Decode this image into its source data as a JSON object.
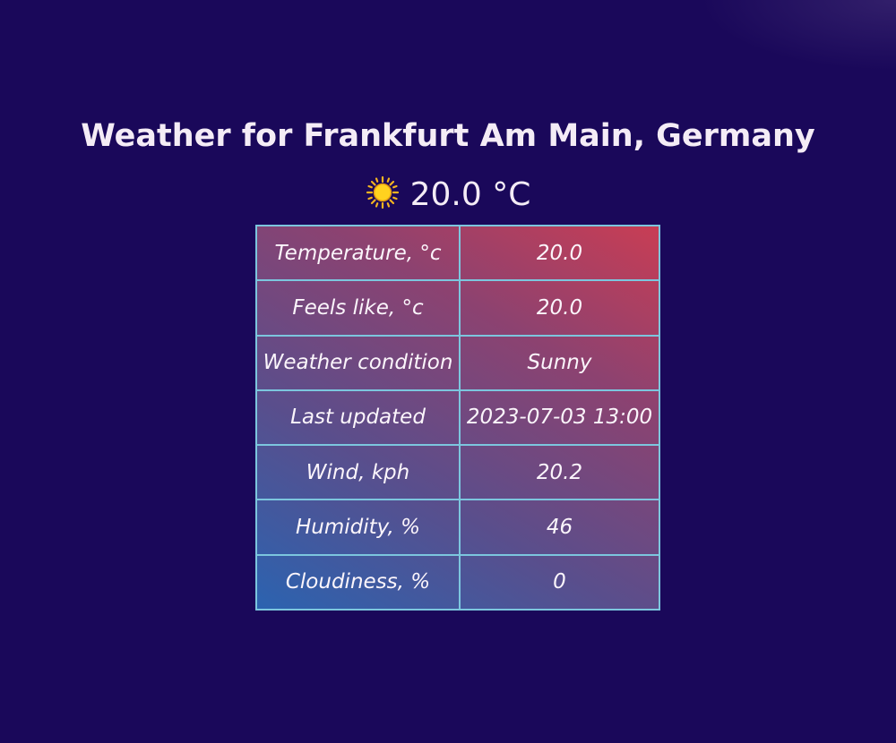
{
  "header": {
    "title": "Weather for Frankfurt Am Main, Germany"
  },
  "current": {
    "icon": "sun-icon",
    "temperature_text": "20.0 °C"
  },
  "table": {
    "rows": [
      {
        "label": "Temperature, °c",
        "value": "20.0"
      },
      {
        "label": "Feels like, °c",
        "value": "20.0"
      },
      {
        "label": "Weather condition",
        "value": "Sunny"
      },
      {
        "label": "Last updated",
        "value": "2023-07-03 13:00"
      },
      {
        "label": "Wind, kph",
        "value": "20.2"
      },
      {
        "label": "Humidity, %",
        "value": "46"
      },
      {
        "label": "Cloudiness, %",
        "value": "0"
      }
    ]
  },
  "colors": {
    "background": "#1a085a",
    "table_border": "#7cc6de",
    "gradient_start": "#2b63b0",
    "gradient_end": "#c93d54",
    "text": "#f4ecf6"
  }
}
